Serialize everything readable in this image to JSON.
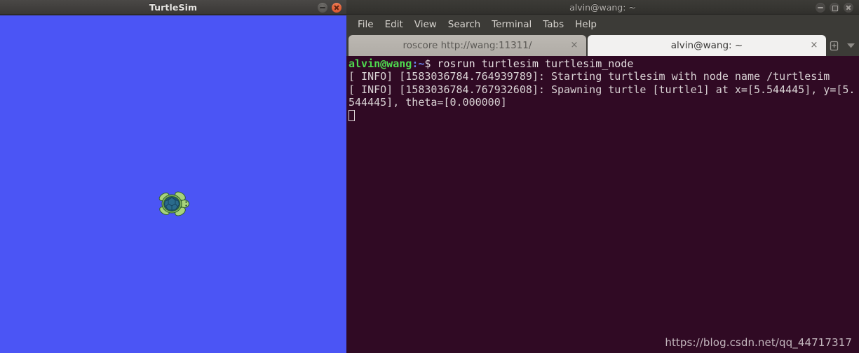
{
  "turtlesim": {
    "title": "TurtleSim",
    "minimize_label": "Minimize",
    "close_label": "Close",
    "background_color": "#4b55f5",
    "turtle": {
      "name": "turtle1",
      "x": "5.544445",
      "y": "5.544445",
      "theta": "0.000000"
    }
  },
  "terminal": {
    "title": "alvin@wang: ~",
    "minimize_label": "Minimize",
    "maximize_label": "Maximize",
    "close_label": "Close",
    "background_color": "#300a24",
    "menu": [
      {
        "label": "File"
      },
      {
        "label": "Edit"
      },
      {
        "label": "View"
      },
      {
        "label": "Search"
      },
      {
        "label": "Terminal"
      },
      {
        "label": "Tabs"
      },
      {
        "label": "Help"
      }
    ],
    "tabs": [
      {
        "label": "roscore http://wang:11311/",
        "close_label": "×",
        "active": false
      },
      {
        "label": "alvin@wang: ~",
        "close_label": "×",
        "active": true
      }
    ],
    "new_tab_label": "New Tab",
    "tab_list_label": "Tab list",
    "lines": [
      {
        "type": "prompt",
        "user_host": "alvin@wang",
        "path": ":~",
        "sigil": "$",
        "command": " rosrun turtlesim turtlesim_node"
      },
      {
        "type": "output",
        "text": "[ INFO] [1583036784.764939789]: Starting turtlesim with node name /turtlesim"
      },
      {
        "type": "output",
        "text": "[ INFO] [1583036784.767932608]: Spawning turtle [turtle1] at x=[5.544445], y=[5.544445], theta=[0.000000]"
      }
    ]
  },
  "watermark": {
    "text": "https://blog.csdn.net/qq_44717317"
  }
}
